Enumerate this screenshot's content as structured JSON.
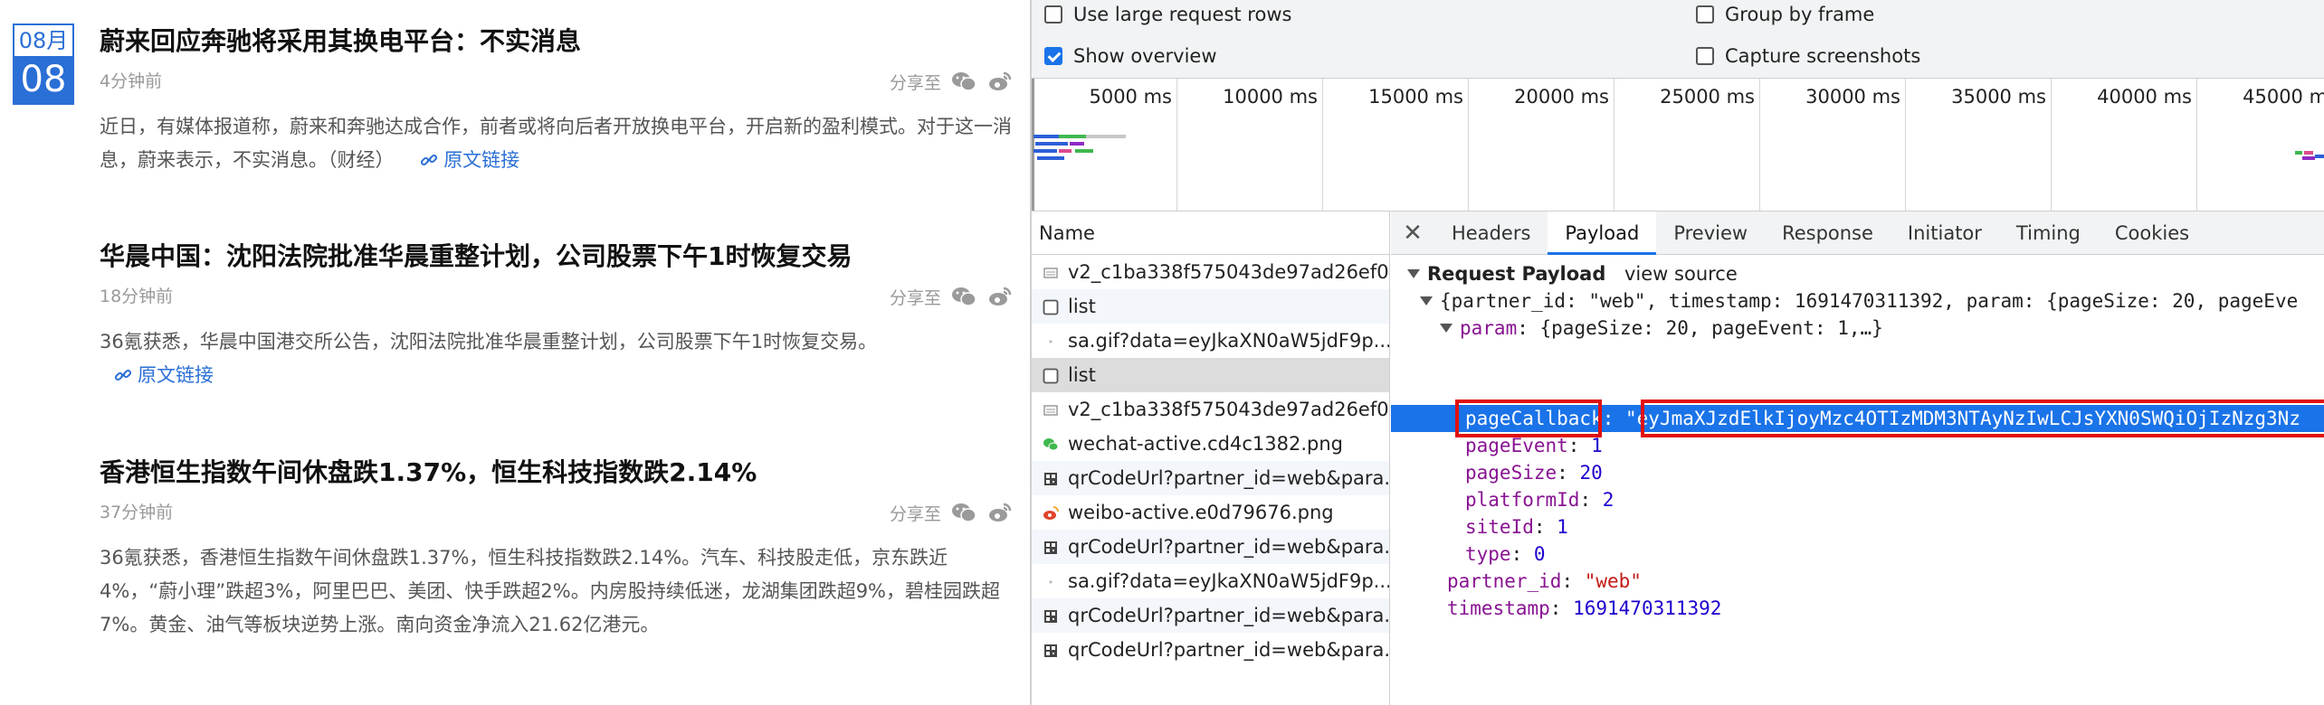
{
  "news": {
    "date_month": "08月",
    "date_day": "08",
    "share_label": "分享至",
    "articles": [
      {
        "title": "蔚来回应奔驰将采用其换电平台：不实消息",
        "time": "4分钟前",
        "body": "近日，有媒体报道称，蔚来和奔驰达成合作，前者或将向后者开放换电平台，开启新的盈利模式。对于这一消息，蔚来表示，不实消息。（财经）",
        "link": "原文链接"
      },
      {
        "title": "华晨中国：沈阳法院批准华晨重整计划，公司股票下午1时恢复交易",
        "time": "18分钟前",
        "body": "36氪获悉，华晨中国港交所公告，沈阳法院批准华晨重整计划，公司股票下午1时恢复交易。",
        "link": "原文链接"
      },
      {
        "title": "香港恒生指数午间休盘跌1.37%，恒生科技指数跌2.14%",
        "time": "37分钟前",
        "body": "36氪获悉，香港恒生指数午间休盘跌1.37%，恒生科技指数跌2.14%。汽车、科技股走低，京东跌近4%，“蔚小理”跌超3%，阿里巴巴、美团、快手跌超2%。内房股持续低迷，龙湖集团跌超9%，碧桂园跌超7%。黄金、油气等板块逆势上涨。南向资金净流入21.62亿港元。"
      }
    ]
  },
  "devtools": {
    "options": {
      "large_rows": {
        "label": "Use large request rows",
        "checked": false
      },
      "show_overview": {
        "label": "Show overview",
        "checked": true
      },
      "group_by_frame": {
        "label": "Group by frame",
        "checked": false
      },
      "capture_screenshots": {
        "label": "Capture screenshots",
        "checked": false
      }
    },
    "timeline_ticks": [
      "5000 ms",
      "10000 ms",
      "15000 ms",
      "20000 ms",
      "25000 ms",
      "30000 ms",
      "35000 ms",
      "40000 ms",
      "45000 ms"
    ],
    "name_header": "Name",
    "requests": [
      {
        "name": "v2_c1ba338f575043de97ad26ef0...",
        "icon": "document-icon"
      },
      {
        "name": "list",
        "icon": "checkbox-icon"
      },
      {
        "name": "sa.gif?data=eyJkaXN0aW5jdF9p...",
        "icon": "dot-icon"
      },
      {
        "name": "list",
        "icon": "checkbox-icon"
      },
      {
        "name": "v2_c1ba338f575043de97ad26ef0...",
        "icon": "document-icon"
      },
      {
        "name": "wechat-active.cd4c1382.png",
        "icon": "wechat-image-icon"
      },
      {
        "name": "qrCodeUrl?partner_id=web&para...",
        "icon": "qr-icon"
      },
      {
        "name": "weibo-active.e0d79676.png",
        "icon": "weibo-image-icon"
      },
      {
        "name": "qrCodeUrl?partner_id=web&para...",
        "icon": "qr-icon"
      },
      {
        "name": "sa.gif?data=eyJkaXN0aW5jdF9p...",
        "icon": "dot-icon"
      },
      {
        "name": "qrCodeUrl?partner_id=web&para...",
        "icon": "qr-icon"
      },
      {
        "name": "qrCodeUrl?partner_id=web&para...",
        "icon": "qr-icon"
      }
    ],
    "tabs": [
      "Headers",
      "Payload",
      "Preview",
      "Response",
      "Initiator",
      "Timing",
      "Cookies"
    ],
    "active_tab": "Payload",
    "payload": {
      "section_title": "Request Payload",
      "view_source": "view source",
      "root_summary": "{partner_id: \"web\", timestamp: 1691470311392, param: {pageSize: 20, pageEve",
      "param_key": "param",
      "param_summary": "{pageSize: 20, pageEvent: 1,…}",
      "page_callback_key": "pageCallback",
      "page_callback_value": "\"eyJmaXJzdElkIjoyMzc4OTIzMDM3NTAyNzIwLCJsYXN0SWQiOjIzNzg3Nz",
      "page_event_key": "pageEvent",
      "page_event_value": "1",
      "page_size_key": "pageSize",
      "page_size_value": "20",
      "platform_id_key": "platformId",
      "platform_id_value": "2",
      "site_id_key": "siteId",
      "site_id_value": "1",
      "type_key": "type",
      "type_value": "0",
      "partner_id_key": "partner_id",
      "partner_id_value": "\"web\"",
      "timestamp_key": "timestamp",
      "timestamp_value": "1691470311392"
    }
  }
}
